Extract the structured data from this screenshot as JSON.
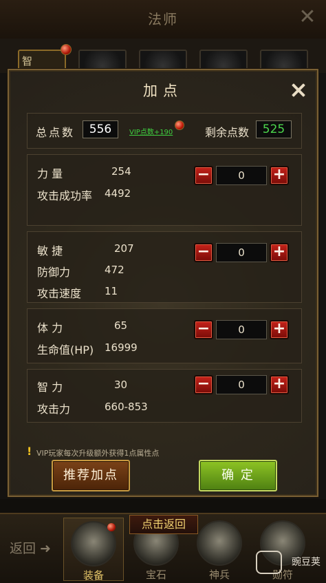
{
  "background": {
    "title": "法师",
    "slot_label": "智",
    "back_label": "返回",
    "return_banner": "点击返回",
    "tabs": [
      {
        "label": "装备",
        "active": true
      },
      {
        "label": "宝石",
        "active": false
      },
      {
        "label": "神兵",
        "active": false
      },
      {
        "label": "勋符",
        "active": false
      }
    ],
    "watermark": "豌豆荚"
  },
  "dialog": {
    "title": "加点",
    "summary": {
      "total_label": "总点数",
      "total_value": "556",
      "vip_link": "VIP点数+190",
      "remaining_label": "剩余点数",
      "remaining_value": "525"
    },
    "attributes": [
      {
        "name": "力 量",
        "value": "254",
        "allocated": "0",
        "derived": [
          {
            "label": "攻击成功率",
            "value": "4492"
          }
        ]
      },
      {
        "name": "敏 捷",
        "value": "207",
        "allocated": "0",
        "derived": [
          {
            "label": "防御力",
            "value": "472"
          },
          {
            "label": "攻击速度",
            "value": "11"
          }
        ]
      },
      {
        "name": "体 力",
        "value": "65",
        "allocated": "0",
        "derived": [
          {
            "label": "生命值(HP)",
            "value": "16999"
          }
        ]
      },
      {
        "name": "智 力",
        "value": "30",
        "allocated": "0",
        "derived": [
          {
            "label": "攻击力",
            "value": "660-853"
          }
        ]
      }
    ],
    "tip": "VIP玩家每次升级额外获得1点属性点",
    "recommend_button": "推荐加点",
    "confirm_button": "确 定"
  },
  "colors": {
    "remaining_value": "#4cd64c",
    "total_value": "#ffffff",
    "vip_link": "#3fd040",
    "confirm_button": "#6aa81a",
    "recommend_button": "#6a3812",
    "step_button": "#b01a12"
  },
  "icons": {
    "close": "close-icon",
    "minus": "minus-icon",
    "plus": "plus-icon",
    "tip": "exclamation-icon"
  }
}
